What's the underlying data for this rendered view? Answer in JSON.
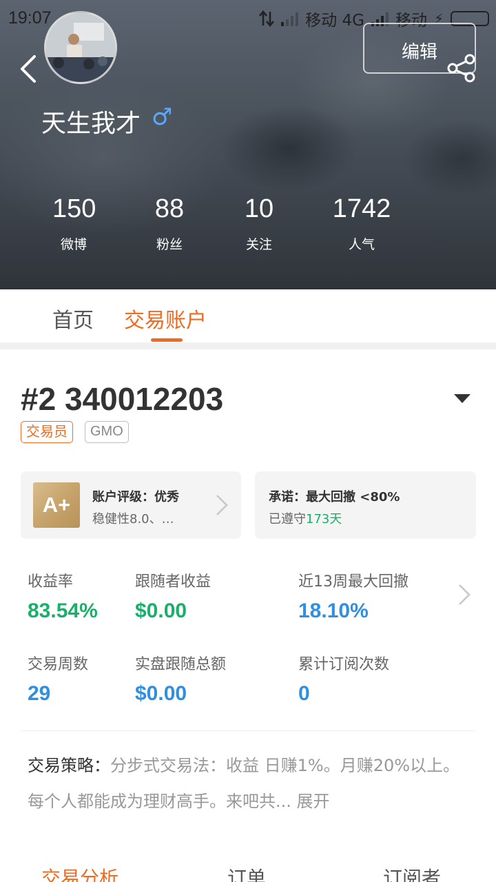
{
  "status": {
    "time": "19:07",
    "carrier1": "移动 4G",
    "carrier2": "移动"
  },
  "profile": {
    "name": "天生我才",
    "gender_symbol": "♂",
    "edit_label": "编辑",
    "stats": [
      {
        "value": "150",
        "label": "微博"
      },
      {
        "value": "88",
        "label": "粉丝"
      },
      {
        "value": "10",
        "label": "关注"
      },
      {
        "value": "1742",
        "label": "人气"
      }
    ]
  },
  "tabs": [
    {
      "label": "首页",
      "active": false
    },
    {
      "label": "交易账户",
      "active": true
    }
  ],
  "account": {
    "title": "#2 340012203",
    "badges": [
      "交易员",
      "GMO"
    ],
    "rating": {
      "grade": "A+",
      "line1": "账户评级：优秀",
      "line2": "稳健性8.0、…"
    },
    "promise": {
      "line1": "承诺：最大回撤 <80%",
      "line2_prefix": "已遵守",
      "line2_days": "173天"
    },
    "metrics": [
      {
        "label": "收益率",
        "value": "83.54%",
        "color": "#18b06a"
      },
      {
        "label": "跟随者收益",
        "value": "$0.00",
        "color": "#18b06a"
      },
      {
        "label": "近13周最大回撤",
        "value": "18.10%",
        "color": "#2f8fe0"
      },
      {
        "label": "交易周数",
        "value": "29",
        "color": "#2f8fe0"
      },
      {
        "label": "实盘跟随总额",
        "value": "$0.00",
        "color": "#2f8fe0"
      },
      {
        "label": "累计订阅次数",
        "value": "0",
        "color": "#2f8fe0"
      }
    ],
    "strategy": {
      "label": "交易策略：",
      "text": "分步式交易法：收益 日赚1%。月赚20%以上。每个人都能成为理财高手。来吧共...",
      "more": "展开"
    }
  },
  "bottom_tabs": [
    {
      "label": "交易分析",
      "active": true
    },
    {
      "label": "订单",
      "active": false
    },
    {
      "label": "订阅者",
      "active": false
    }
  ],
  "colors": {
    "accent": "#f26b1d",
    "gain": "#18b06a",
    "info": "#2f8fe0"
  }
}
